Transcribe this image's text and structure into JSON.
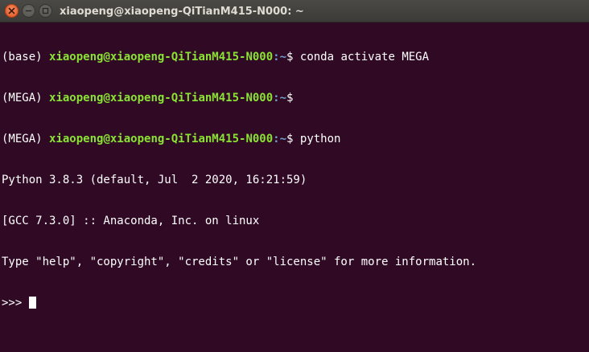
{
  "window": {
    "title": "xiaopeng@xiaopeng-QiTianM415-N000: ~"
  },
  "terminal": {
    "lines": [
      {
        "env": "(base) ",
        "userhost": "xiaopeng@xiaopeng-QiTianM415-N000",
        "path": ":~",
        "sym": "$ ",
        "cmd": "conda activate MEGA"
      },
      {
        "env": "(MEGA) ",
        "userhost": "xiaopeng@xiaopeng-QiTianM415-N000",
        "path": ":~",
        "sym": "$",
        "cmd": ""
      },
      {
        "env": "(MEGA) ",
        "userhost": "xiaopeng@xiaopeng-QiTianM415-N000",
        "path": ":~",
        "sym": "$ ",
        "cmd": "python"
      }
    ],
    "output": [
      "Python 3.8.3 (default, Jul  2 2020, 16:21:59)",
      "[GCC 7.3.0] :: Anaconda, Inc. on linux",
      "Type \"help\", \"copyright\", \"credits\" or \"license\" for more information."
    ],
    "repl_prompt": ">>> "
  },
  "colors": {
    "background": "#300a24",
    "userhost": "#8ae234",
    "path": "#729fcf",
    "text": "#ffffff",
    "close_button": "#e2531d"
  },
  "icons": [
    "close-icon",
    "minimize-icon",
    "maximize-icon"
  ]
}
